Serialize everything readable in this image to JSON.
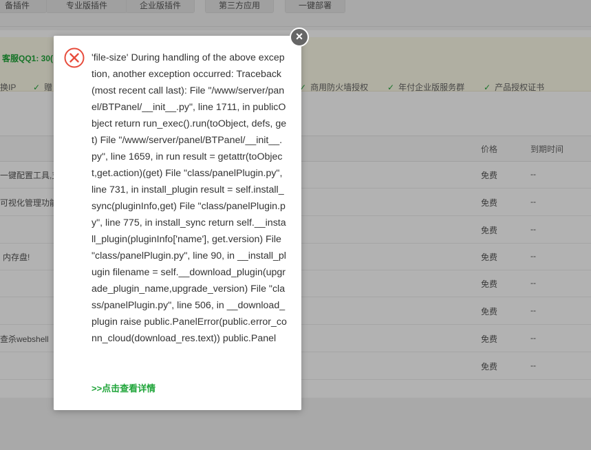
{
  "top_tabs": [
    "备插件",
    "专业版插件",
    "企业版插件",
    "第三方应用",
    "一键部署"
  ],
  "notice": {
    "qq": "客服QQ1: 30(",
    "features": [
      "换IP",
      "赠",
      "商用防火墙授权",
      "年付企业版服务群",
      "产品授权证书"
    ]
  },
  "table": {
    "headers": {
      "price": "价格",
      "expire": "到期时间"
    },
    "rows": [
      {
        "desc": "一键配置工具,支",
        "price": "免费",
        "expire": "--"
      },
      {
        "desc": "可视化管理功能",
        "price": "免费",
        "expire": "--"
      },
      {
        "desc": "",
        "price": "免费",
        "expire": "--"
      },
      {
        "desc": "内存盘!",
        "price": "免费",
        "expire": "--"
      },
      {
        "desc": "",
        "price": "免费",
        "expire": "--"
      },
      {
        "desc": "",
        "price": "免费",
        "expire": "--"
      },
      {
        "desc": "查杀webshell",
        "price": "免费",
        "expire": "--"
      },
      {
        "desc": "",
        "price": "免费",
        "expire": "--"
      }
    ]
  },
  "dialog": {
    "message": "'file-size' During handling of the above exception, another exception occurred: Traceback (most recent call last): File \"/www/server/panel/BTPanel/__init__.py\", line 1711, in publicObject return run_exec().run(toObject, defs, get) File \"/www/server/panel/BTPanel/__init__.py\", line 1659, in run result = getattr(toObject,get.action)(get) File \"class/panelPlugin.py\", line 731, in install_plugin result = self.install_sync(pluginInfo,get) File \"class/panelPlugin.py\", line 775, in install_sync return self.__install_plugin(pluginInfo['name'], get.version) File \"class/panelPlugin.py\", line 90, in __install_plugin filename = self.__download_plugin(upgrade_plugin_name,upgrade_version) File \"class/panelPlugin.py\", line 506, in __download_plugin raise public.PanelError(public.error_conn_cloud(download_res.text)) public.Panel",
    "detail_link": ">>点击查看详情",
    "close_symbol": "×",
    "icon": "error-x-icon",
    "accent_color": "#20a53a",
    "error_color": "#e74c3c"
  }
}
